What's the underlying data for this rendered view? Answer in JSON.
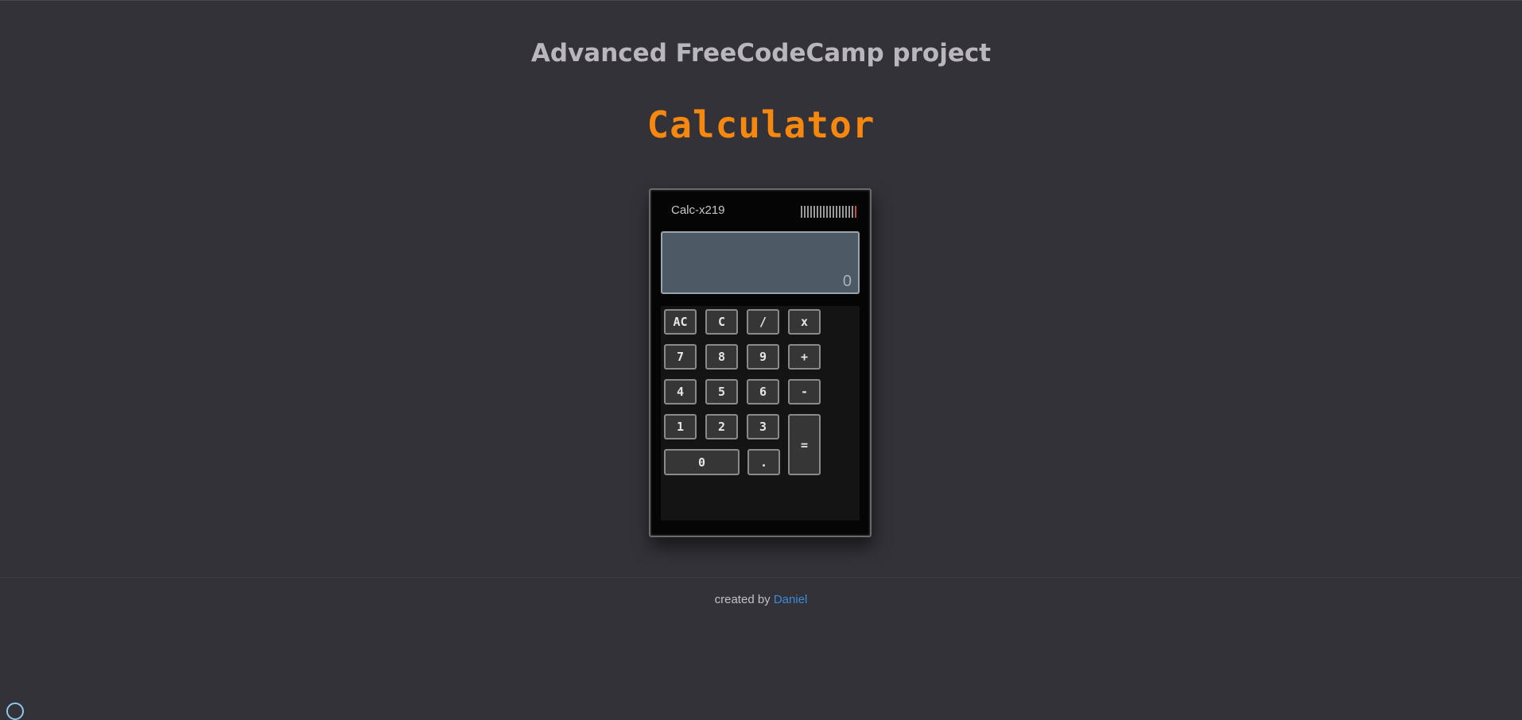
{
  "page": {
    "heading": "Advanced FreeCodeCamp project",
    "title": "Calculator"
  },
  "calculator": {
    "brand": "Calc-x219",
    "display_value": "0",
    "keys": {
      "ac": "AC",
      "c": "C",
      "divide": "/",
      "multiply": "x",
      "seven": "7",
      "eight": "8",
      "nine": "9",
      "plus": "+",
      "four": "4",
      "five": "5",
      "six": "6",
      "minus": "-",
      "one": "1",
      "two": "2",
      "three": "3",
      "equals": "=",
      "zero": "0",
      "decimal": "."
    }
  },
  "footer": {
    "prefix": "created by",
    "author_link": "Daniel"
  },
  "colors": {
    "background": "#333238",
    "title_accent": "#f7880f",
    "link": "#3d8bd9",
    "display": "#4d5a66"
  }
}
